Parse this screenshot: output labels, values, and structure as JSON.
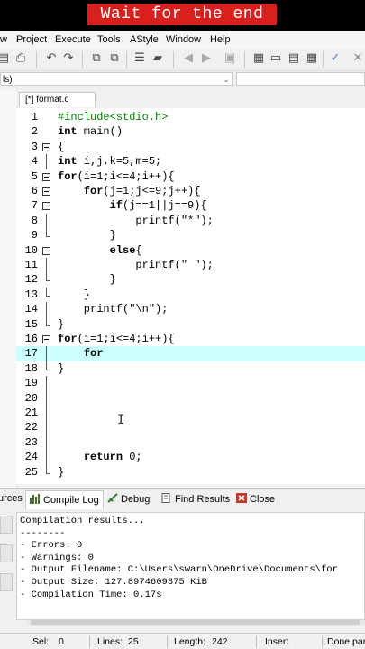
{
  "banner": {
    "text": "Wait for the end"
  },
  "menu": [
    "w",
    "Project",
    "Execute",
    "Tools",
    "AStyle",
    "Window",
    "Help"
  ],
  "combo": {
    "value": "ls)"
  },
  "editor_tab": {
    "label": "[*] format.c"
  },
  "code_lines": [
    {
      "n": "1",
      "text": "#include<stdio.h>"
    },
    {
      "n": "2",
      "text": "int main()"
    },
    {
      "n": "3",
      "text": "{"
    },
    {
      "n": "4",
      "text": "int i,j,k=5,m=5;"
    },
    {
      "n": "5",
      "text": "for(i=1;i<=4;i++){"
    },
    {
      "n": "6",
      "text": "    for(j=1;j<=9;j++){"
    },
    {
      "n": "7",
      "text": "        if(j==1||j==9){"
    },
    {
      "n": "8",
      "text": "            printf(\"*\");"
    },
    {
      "n": "9",
      "text": "        }"
    },
    {
      "n": "10",
      "text": "        else{"
    },
    {
      "n": "11",
      "text": "            printf(\" \");"
    },
    {
      "n": "12",
      "text": "        }"
    },
    {
      "n": "13",
      "text": "    }"
    },
    {
      "n": "14",
      "text": "    printf(\"\\n\");"
    },
    {
      "n": "15",
      "text": "}"
    },
    {
      "n": "16",
      "text": "for(i=1;i<=4;i++){"
    },
    {
      "n": "17",
      "text": "    for"
    },
    {
      "n": "18",
      "text": "}"
    },
    {
      "n": "19",
      "text": ""
    },
    {
      "n": "20",
      "text": ""
    },
    {
      "n": "21",
      "text": ""
    },
    {
      "n": "22",
      "text": ""
    },
    {
      "n": "23",
      "text": ""
    },
    {
      "n": "24",
      "text": "    return 0;"
    },
    {
      "n": "25",
      "text": "}"
    }
  ],
  "bottom_tabs": {
    "resources": "urces",
    "compile_log": "Compile Log",
    "debug": "Debug",
    "find_results": "Find Results",
    "close": "Close"
  },
  "log_lines": [
    "Compilation results...",
    "--------",
    "- Errors: 0",
    "- Warnings: 0",
    "- Output Filename: C:\\Users\\swarn\\OneDrive\\Documents\\for",
    "- Output Size: 127.8974609375 KiB",
    "- Compilation Time: 0.17s"
  ],
  "status": {
    "sel_label": "Sel:",
    "sel_value": "0",
    "lines_label": "Lines:",
    "lines_value": "25",
    "length_label": "Length:",
    "length_value": "242",
    "mode": "Insert",
    "message": "Done par"
  },
  "colors": {
    "banner_bg": "#d8211f",
    "active_line": "#ccffff"
  }
}
